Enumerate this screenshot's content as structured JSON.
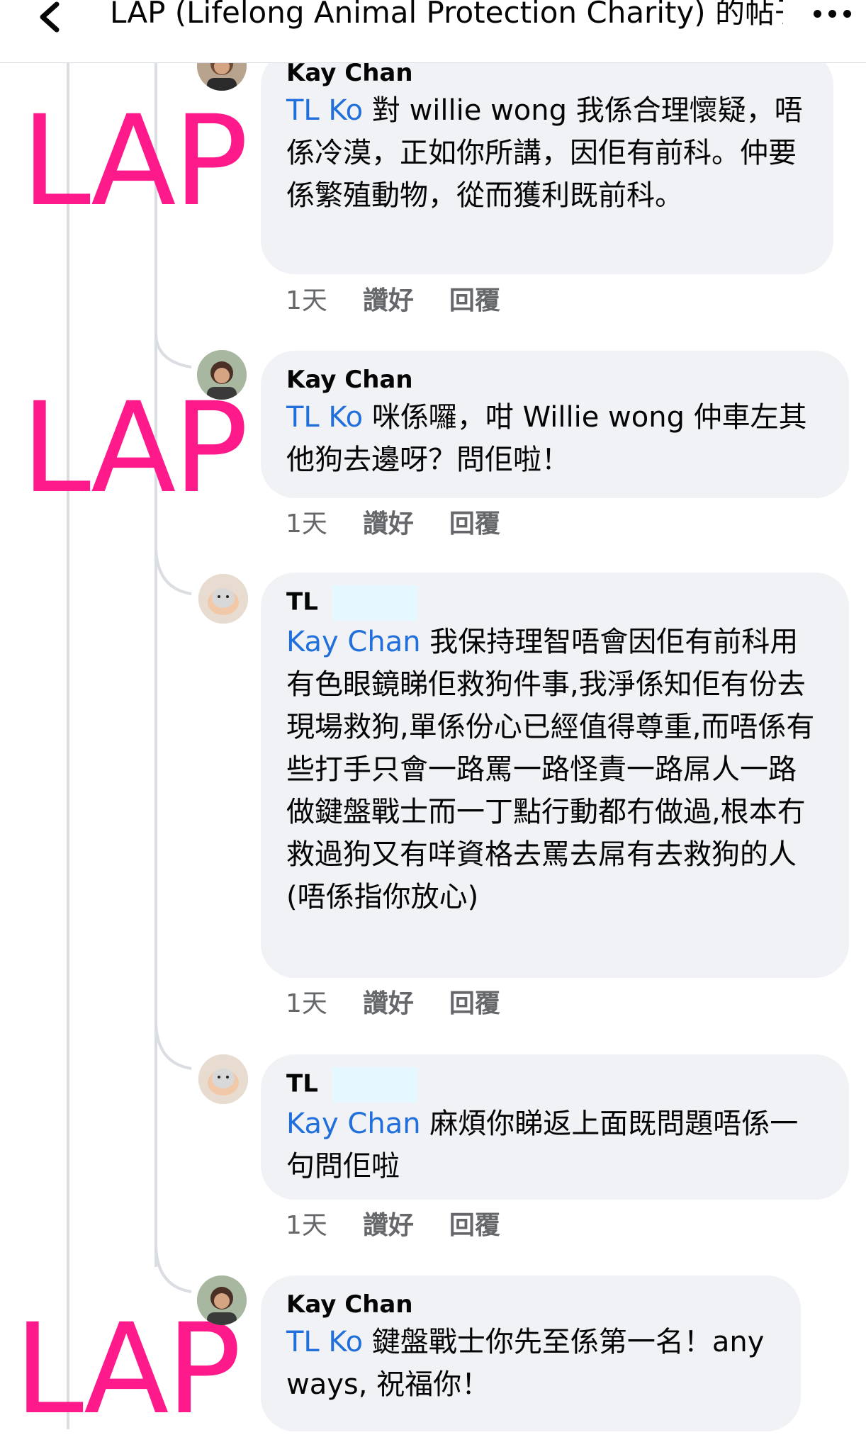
{
  "header": {
    "title": "LAP (Lifelong Animal Protection Charity) 的帖子"
  },
  "watermark_text": "LAP",
  "comments": [
    {
      "author": "Kay Chan",
      "mention": "TL Ko",
      "body": "對 willie wong 我係合理懷疑，唔係冷漠，正如你所講，因佢有前科。仲要係繁殖動物，從而獲利既前科。",
      "time": "1天",
      "like": "讚好",
      "reply": "回覆"
    },
    {
      "author": "Kay Chan",
      "mention": "TL Ko",
      "body": "  咪係囉，咁 Willie wong 仲車左其他狗去邊呀？問佢啦！",
      "time": "1天",
      "like": "讚好",
      "reply": "回覆"
    },
    {
      "author": "TL",
      "mention": "Kay Chan",
      "body": " 我保持理智唔會因佢有前科用有色眼鏡睇佢救狗件事,我淨係知佢有份去現場救狗,單係份心已經值得尊重,而唔係有些打手只會一路罵一路怪責一路屌人一路做鍵盤戰士而一丁點行動都冇做過,根本冇救過狗又有咩資格去罵去屌有去救狗的人 (唔係指你放心)",
      "time": "1天",
      "like": "讚好",
      "reply": "回覆"
    },
    {
      "author": "TL",
      "mention": "Kay Chan",
      "body": " 麻煩你睇返上面既問題唔係一句問佢啦",
      "time": "1天",
      "like": "讚好",
      "reply": "回覆"
    },
    {
      "author": "Kay Chan",
      "mention": "TL Ko",
      "body": "  鍵盤戰士你先至係第一名！anyways, 祝福你！",
      "time": "",
      "like": "",
      "reply": ""
    }
  ]
}
